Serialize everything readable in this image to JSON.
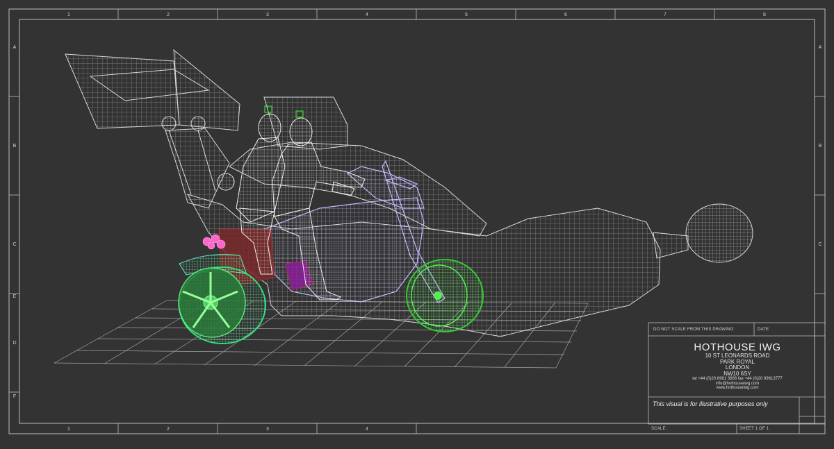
{
  "columns": [
    "1",
    "2",
    "3",
    "4",
    "5",
    "6",
    "7",
    "8"
  ],
  "rows": [
    "A",
    "B",
    "C",
    "E",
    "D",
    "F"
  ],
  "title_block": {
    "note": "DO NOT SCALE FROM THIS DRAWING",
    "date_label": "DATE",
    "company_name": "HOTHOUSE IWG",
    "address_lines": [
      "10 ST LEONARDS ROAD",
      "PARK ROYAL",
      "LONDON",
      "NW10 6SY"
    ],
    "phone": "tel +44 (0)20 8961 3666  fax +44 (0)20 89613777",
    "email": "info@hothouseiwg.com",
    "website": "www.hothouseiwg.com",
    "disclaimer": "This visual is for illustrative purposes only",
    "scale_label": "SCALE:",
    "sheet_label": "SHEET 1 OF 1"
  },
  "colors": {
    "background": "#333333",
    "wireframe": "#d9d9d9",
    "bike_frame": "#b3a6f2",
    "front_wheel": "#33cc33",
    "rear_wheel": "#2ee07a",
    "rear_fender": "#66e0c8",
    "accent_pink": "#ff66cc",
    "rider_mesh": "#ececec"
  }
}
